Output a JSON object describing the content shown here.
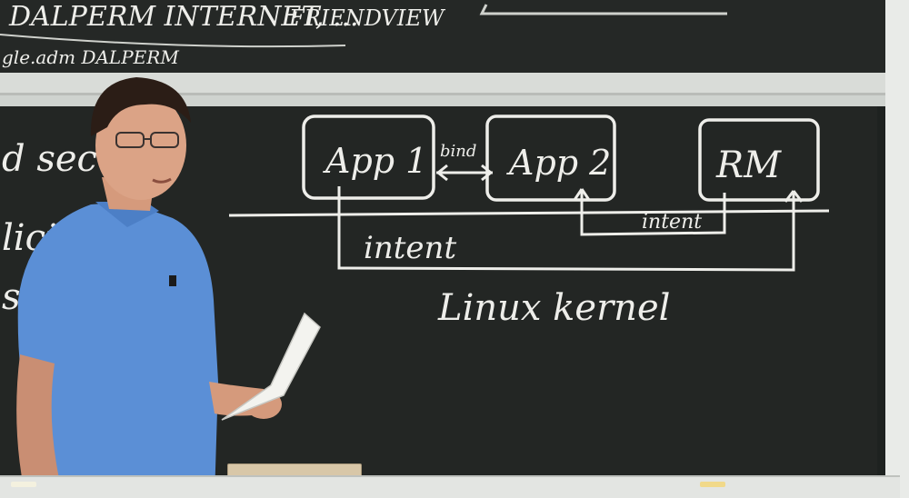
{
  "upper_board": {
    "line1": "DALPERM INTERNET, ...",
    "line1b": "FRIENDVIEW",
    "line2": "gle.adm DALPERM"
  },
  "left_edge": {
    "fragment1": "d sec",
    "fragment2": "lici",
    "fragment3": "s"
  },
  "diagram": {
    "app1": "App 1",
    "app2": "App 2",
    "rm": "RM",
    "bind_label": "bind",
    "intent_short": "intent",
    "intent_long": "intent",
    "kernel": "Linux kernel"
  },
  "colors": {
    "chalk": "#eeeeea",
    "board": "#232624",
    "shirt": "#5b8fd6"
  }
}
